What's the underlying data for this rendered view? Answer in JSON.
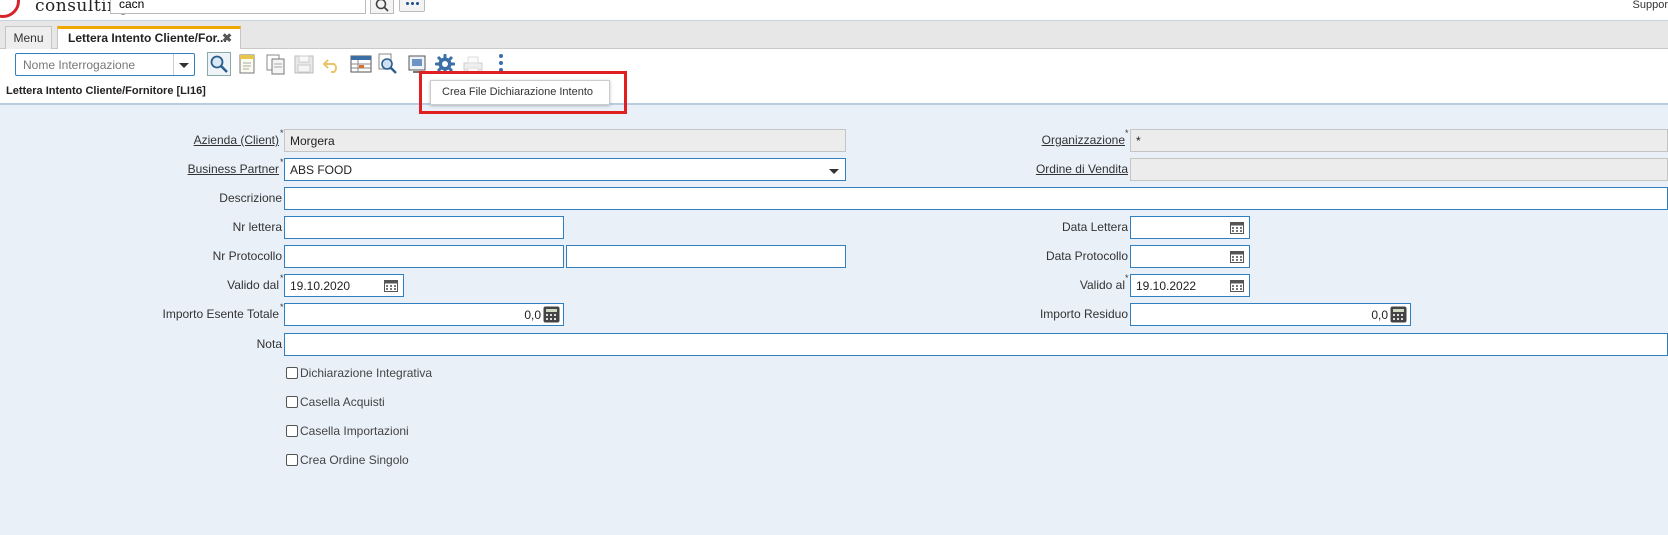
{
  "header": {
    "logo_text": "consulting",
    "search_value": "cacn",
    "support_label": "Suppor"
  },
  "tabs": [
    {
      "label": "Menu"
    },
    {
      "label": "Lettera Intento Cliente/For...",
      "close": "✖"
    }
  ],
  "toolbar": {
    "query_placeholder": "Nome Interrogazione"
  },
  "window_title": "Lettera Intento Cliente/Fornitore [LI16]",
  "popup": {
    "label": "Crea File Dichiarazione Intento"
  },
  "form": {
    "azienda": {
      "label": "Azienda (Client)",
      "value": "Morgera"
    },
    "organizzazione": {
      "label": "Organizzazione",
      "value": "*"
    },
    "business_partner": {
      "label": "Business Partner",
      "value": "ABS FOOD"
    },
    "ordine_vendita": {
      "label": "Ordine di Vendita",
      "value": ""
    },
    "descrizione": {
      "label": "Descrizione",
      "value": ""
    },
    "nr_lettera": {
      "label": "Nr lettera",
      "value": ""
    },
    "data_lettera": {
      "label": "Data Lettera",
      "value": ""
    },
    "nr_protocollo": {
      "label": "Nr Protocollo",
      "value": ""
    },
    "data_protocollo": {
      "label": "Data Protocollo",
      "value": ""
    },
    "valido_dal": {
      "label": "Valido dal",
      "value": "19.10.2020"
    },
    "valido_al": {
      "label": "Valido al",
      "value": "19.10.2022"
    },
    "importo_esente": {
      "label": "Importo Esente Totale",
      "value": "0,0"
    },
    "importo_residuo": {
      "label": "Importo Residuo",
      "value": "0,0"
    },
    "nota": {
      "label": "Nota",
      "value": ""
    },
    "required_marker": "*",
    "checkboxes": [
      {
        "label": "Dichiarazione Integrativa",
        "checked": false
      },
      {
        "label": "Casella Acquisti",
        "checked": false
      },
      {
        "label": "Casella Importazioni",
        "checked": false
      },
      {
        "label": "Crea Ordine Singolo",
        "checked": false
      }
    ]
  }
}
